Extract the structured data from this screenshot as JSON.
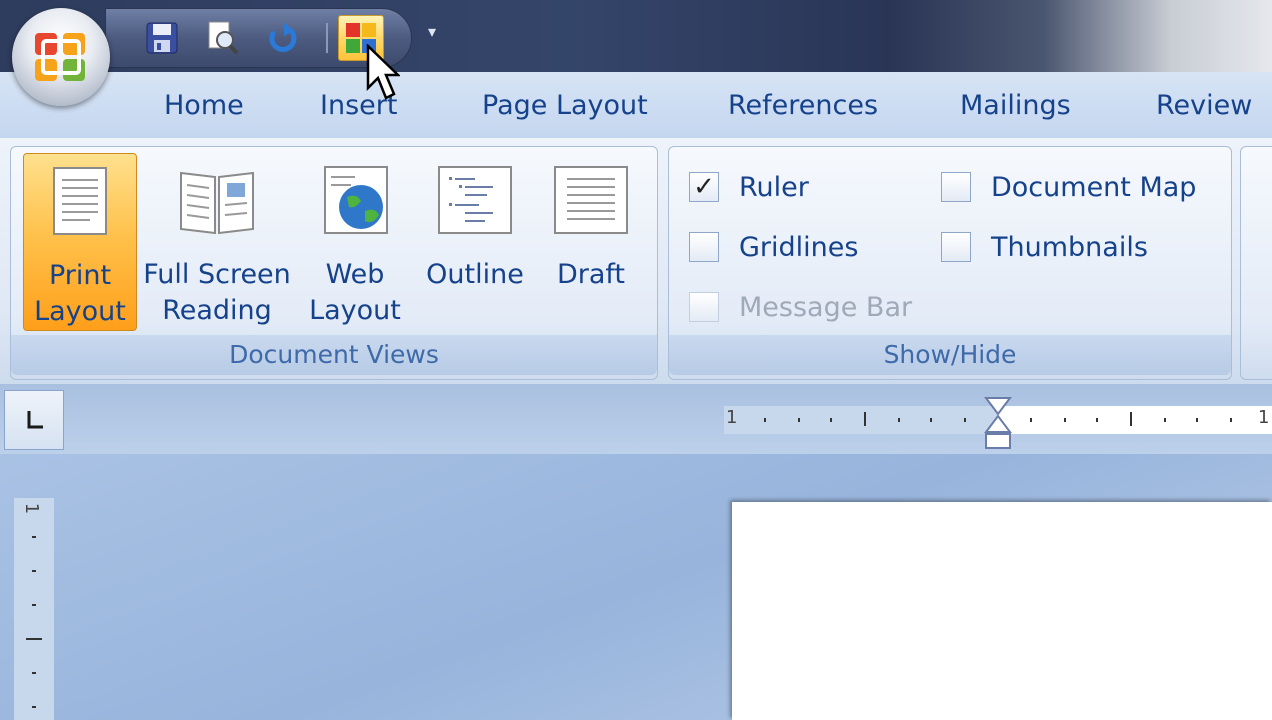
{
  "quick_access": {
    "buttons": [
      "save-icon",
      "print-preview-icon",
      "undo-icon",
      "view-layout-icon"
    ],
    "more": "▾"
  },
  "tabs": [
    "Home",
    "Insert",
    "Page Layout",
    "References",
    "Mailings",
    "Review"
  ],
  "ribbon": {
    "document_views": {
      "label": "Document Views",
      "buttons": [
        {
          "line1": "Print",
          "line2": "Layout",
          "active": true
        },
        {
          "line1": "Full Screen",
          "line2": "Reading",
          "active": false
        },
        {
          "line1": "Web",
          "line2": "Layout",
          "active": false
        },
        {
          "line1": "Outline",
          "line2": "",
          "active": false
        },
        {
          "line1": "Draft",
          "line2": "",
          "active": false
        }
      ]
    },
    "show_hide": {
      "label": "Show/Hide",
      "ruler": {
        "label": "Ruler",
        "checked": true
      },
      "gridlines": {
        "label": "Gridlines",
        "checked": false
      },
      "message_bar": {
        "label": "Message Bar",
        "checked": false,
        "enabled": false
      },
      "document_map": {
        "label": "Document Map",
        "checked": false
      },
      "thumbnails": {
        "label": "Thumbnails",
        "checked": false
      }
    }
  },
  "ruler": {
    "left_number": "1",
    "right_number": "1",
    "vertical_number": "1"
  },
  "colors": {
    "tab_text": "#15428b",
    "active_button": "#ffc24d",
    "group_label": "#3e6aaa"
  }
}
